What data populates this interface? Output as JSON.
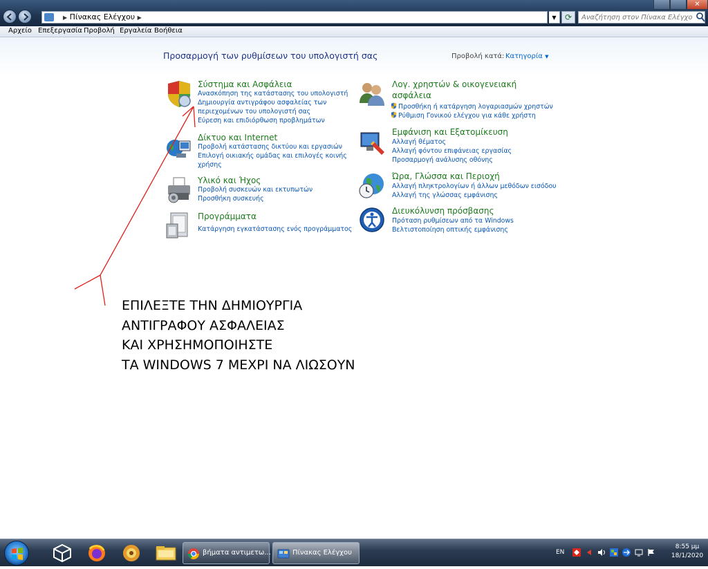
{
  "window": {
    "breadcrumb": "Πίνακας Ελέγχου",
    "search_placeholder": "Αναζήτηση στον Πίνακα Ελέγχου"
  },
  "menubar": [
    "Αρχείο",
    "Επεξεργασία",
    "Προβολή",
    "Εργαλεία",
    "Βοήθεια"
  ],
  "header": {
    "title": "Προσαρμογή των ρυθμίσεων του υπολογιστή σας",
    "view_by_label": "Προβολή κατά:",
    "view_by_value": "Κατηγορία"
  },
  "left_categories": [
    {
      "title": "Σύστημα και Ασφάλεια",
      "icon": "shield-icon",
      "links": [
        "Ανασκόπηση της κατάστασης του υπολογιστή",
        "Δημιουργία αντιγράφου ασφαλείας των",
        "περιεχομένων του υπολογιστή σας",
        "Εύρεση και επιδιόρθωση προβλημάτων"
      ]
    },
    {
      "title": "Δίκτυο και Internet",
      "icon": "network-icon",
      "links": [
        "Προβολή κατάστασης δικτύου και εργασιών",
        "Επιλογή οικιακής ομάδας και επιλογές κοινής",
        "χρήσης"
      ]
    },
    {
      "title": "Υλικό και Ήχος",
      "icon": "printer-icon",
      "links": [
        "Προβολή συσκευών και εκτυπωτών",
        "Προσθήκη συσκευής"
      ]
    },
    {
      "title": "Προγράμματα",
      "icon": "programs-icon",
      "links": [
        "Κατάργηση εγκατάστασης ενός προγράμματος"
      ]
    }
  ],
  "right_categories": [
    {
      "title_line1": "Λογ. χρηστών & οικογενειακή",
      "title_line2": "ασφάλεια",
      "icon": "users-icon",
      "links": [
        "Προσθήκη ή κατάργηση λογαριασμών χρηστών",
        "Ρύθμιση Γονικού ελέγχου για κάθε χρήστη"
      ]
    },
    {
      "title": "Εμφάνιση και Εξατομίκευση",
      "icon": "appearance-icon",
      "links": [
        "Αλλαγή θέματος",
        "Αλλαγή φόντου επιφάνειας εργασίας",
        "Προσαρμογή ανάλυσης οθόνης"
      ]
    },
    {
      "title": "Ώρα, Γλώσσα και Περιοχή",
      "icon": "clock-globe-icon",
      "links": [
        "Αλλαγή πληκτρολογίων ή άλλων μεθόδων εισόδου",
        "Αλλαγή της γλώσσας εμφάνισης"
      ]
    },
    {
      "title": "Διευκόλυνση πρόσβασης",
      "icon": "accessibility-icon",
      "links": [
        "Πρόταση ρυθμίσεων από τα Windows",
        "Βελτιστοποίηση οπτικής εμφάνισης"
      ]
    }
  ],
  "annotation": {
    "lines": [
      "ΕΠΙΛΕΞΤΕ ΤΗΝ ΔΗΜΙΟΥΡΓΙΑ",
      "ΑΝΤΙΓΡΑΦΟΥ ΑΣΦΑΛΕΙΑΣ",
      "ΚΑΙ ΧΡΗΣΗΜΟΠΟΙΗΣΤΕ",
      "ΤΑ WINDOWS 7 ΜΕΧΡΙ ΝΑ ΛΙΩΣΟΥΝ"
    ],
    "arrow_color": "#e0201a"
  },
  "taskbar": {
    "tasks": [
      {
        "label": "βήματα αντιμετω...",
        "icon": "chrome-icon"
      },
      {
        "label": "Πίνακας Ελέγχου",
        "icon": "control-panel-icon"
      }
    ],
    "language": "EN",
    "time": "8:55 μμ",
    "date": "18/1/2020"
  },
  "colors": {
    "category_title": "#1e7b1e",
    "link": "#0a56b3",
    "page_title": "#1e3287"
  }
}
